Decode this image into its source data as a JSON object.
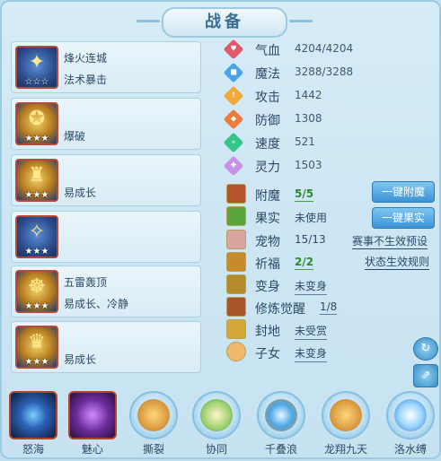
{
  "window": {
    "title": "战备"
  },
  "equipment": [
    {
      "line1": "烽火连城",
      "line2": "法术暴击",
      "stars": "☆☆☆",
      "glyph": "✦"
    },
    {
      "line1": "",
      "line2": "爆破",
      "stars": "★★★",
      "glyph": "✪"
    },
    {
      "line1": "",
      "line2": "易成长",
      "stars": "★★★",
      "glyph": "♜"
    },
    {
      "line1": "",
      "line2": "",
      "stars": "★★★",
      "glyph": "✧"
    },
    {
      "line1": "五雷轰顶",
      "line2": "易成长、冷静",
      "stars": "★★★",
      "glyph": "☸"
    },
    {
      "line1": "",
      "line2": "易成长",
      "stars": "★★★",
      "glyph": "♛"
    }
  ],
  "stats": [
    {
      "label": "气血",
      "value": "4204/4204",
      "color": "#e2586b",
      "icon": "♥"
    },
    {
      "label": "魔法",
      "value": "3288/3288",
      "color": "#4aa3e8",
      "icon": "■"
    },
    {
      "label": "攻击",
      "value": "1442",
      "color": "#f0a93a",
      "icon": "↑"
    },
    {
      "label": "防御",
      "value": "1308",
      "color": "#ec7b3c",
      "icon": "◆"
    },
    {
      "label": "速度",
      "value": "521",
      "color": "#35c48a",
      "icon": "»"
    },
    {
      "label": "灵力",
      "value": "1503",
      "color": "#c793e6",
      "icon": "✚"
    }
  ],
  "props": [
    {
      "label": "附魔",
      "value": "5/5",
      "style": "green"
    },
    {
      "label": "果实",
      "value": "未使用",
      "style": "plain"
    },
    {
      "label": "宠物",
      "value": "15/13",
      "style": "plain"
    },
    {
      "label": "祈福",
      "value": "2/2",
      "style": "green"
    },
    {
      "label": "变身",
      "value": "未变身",
      "style": "under"
    },
    {
      "label": "修炼觉醒",
      "value": "1/8",
      "style": "under"
    },
    {
      "label": "封地",
      "value": "未受赏",
      "style": "under"
    },
    {
      "label": "子女",
      "value": "未变身",
      "style": "under"
    }
  ],
  "buttons": {
    "enchant_all": "一键附魔",
    "fruit_all": "一键果实"
  },
  "links": {
    "event_preset": "赛事不生效预设",
    "status_rules": "状态生效规则"
  },
  "skills": [
    {
      "name": "怒海",
      "style": "sq-blue"
    },
    {
      "name": "魅心",
      "style": "sq-purple"
    },
    {
      "name": "撕裂",
      "style": "gold"
    },
    {
      "name": "协同",
      "style": "green"
    },
    {
      "name": "千叠浪",
      "style": "wave"
    },
    {
      "name": "龙翔九天",
      "style": "gold"
    },
    {
      "name": "洛水缚",
      "style": "ice"
    }
  ],
  "colors": {
    "accent": "#3d93d6",
    "frame": "#9ccbe4",
    "green_value": "#2d8a2d",
    "icon_border_red": "#b34a3a"
  }
}
